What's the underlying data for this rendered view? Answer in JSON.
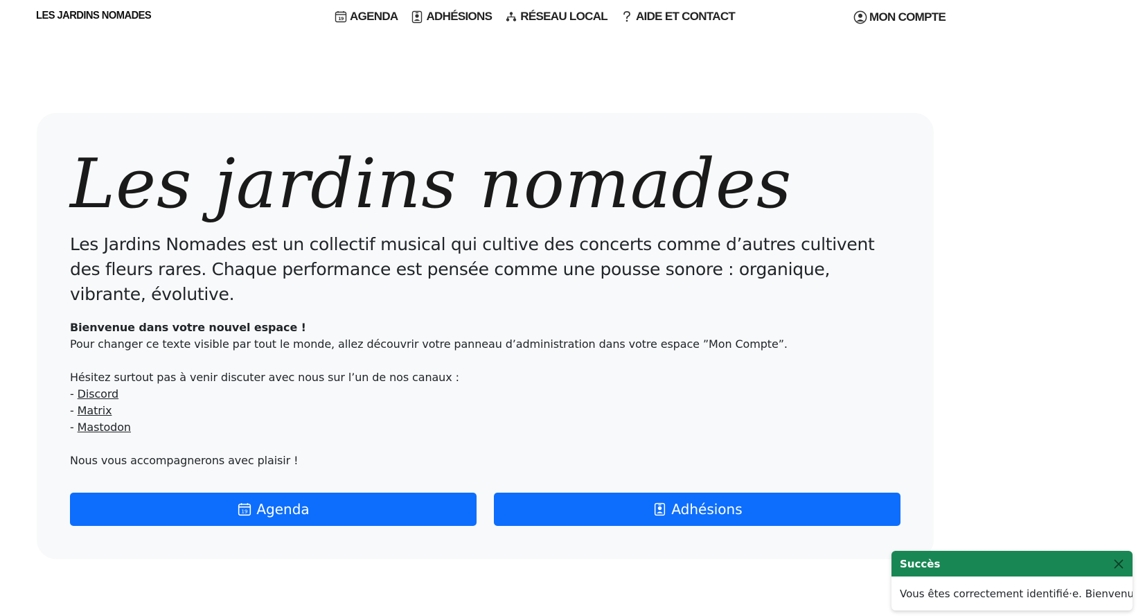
{
  "navbar": {
    "brand": "LES JARDINS NOMADES",
    "links": [
      {
        "label": "AGENDA",
        "icon": "calendar-icon"
      },
      {
        "label": "ADHÉSIONS",
        "icon": "badge-icon"
      },
      {
        "label": "RÉSEAU LOCAL",
        "icon": "network-icon"
      },
      {
        "label": "AIDE ET CONTACT",
        "icon": "question-icon"
      }
    ],
    "account": {
      "label": "MON COMPTE",
      "icon": "user-circle-icon"
    }
  },
  "hero": {
    "title": "Les jardins nomades",
    "lead": "Les Jardins Nomades est un collectif musical qui cultive des concerts comme d’autres cultivent des fleurs rares. Chaque performance est pensée comme une pousse sonore : organique, vibrante, évolutive.",
    "welcome_title": "Bienvenue dans votre nouvel espace !",
    "welcome_text": "Pour changer ce texte visible par tout le monde, allez découvrir votre panneau d’administration dans votre espace ”Mon Compte”.",
    "channels_intro": "Hésitez surtout pas à venir discuter avec nous sur l’un de nos canaux :",
    "channel_prefix": "- ",
    "channels": [
      "Discord",
      "Matrix",
      "Mastodon"
    ],
    "closing": "Nous vous accompagnerons avec plaisir !",
    "buttons": {
      "agenda": {
        "label": "Agenda",
        "icon": "calendar-icon"
      },
      "adhesions": {
        "label": "Adhésions",
        "icon": "badge-icon"
      }
    }
  },
  "toast": {
    "title": "Succès",
    "message": "Vous êtes correctement identifié·e. Bienvenue !",
    "close_icon": "close-icon"
  },
  "colors": {
    "primary": "#0d6efd",
    "success": "#198754",
    "card_bg": "#f8f9fa",
    "text": "#212529"
  }
}
